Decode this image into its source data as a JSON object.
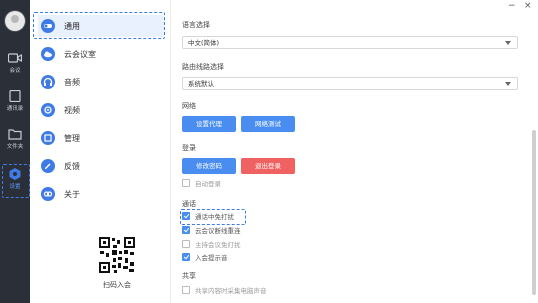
{
  "rail": {
    "items": [
      {
        "label": "会议",
        "icon": "video-camera-icon"
      },
      {
        "label": "通讯录",
        "icon": "contacts-icon"
      },
      {
        "label": "文件夹",
        "icon": "folder-icon"
      },
      {
        "label": "设置",
        "icon": "settings-icon",
        "active": true
      }
    ]
  },
  "categories": [
    {
      "label": "通用",
      "icon": "toggle-icon",
      "active": true
    },
    {
      "label": "云会议室",
      "icon": "cloud-icon"
    },
    {
      "label": "音频",
      "icon": "headphones-icon"
    },
    {
      "label": "视频",
      "icon": "video-icon"
    },
    {
      "label": "管理",
      "icon": "manage-icon"
    },
    {
      "label": "反馈",
      "icon": "feedback-icon"
    },
    {
      "label": "关于",
      "icon": "about-icon"
    }
  ],
  "qr": {
    "label": "扫码入会"
  },
  "window": {
    "minimize": "−",
    "close": "×"
  },
  "settings": {
    "language": {
      "title": "语言选择",
      "value": "中文(简体)"
    },
    "route": {
      "title": "路由线路选择",
      "value": "系统默认"
    },
    "network": {
      "title": "网络",
      "proxy_button": "设置代理",
      "test_button": "网络测试"
    },
    "login": {
      "title": "登录",
      "change_password_button": "修改密码",
      "logout_button": "退出登录",
      "auto_login": "自动登录"
    },
    "call": {
      "title": "通话",
      "options": [
        {
          "label": "通话中免打扰",
          "checked": true
        },
        {
          "label": "云会议断线重连",
          "checked": true
        },
        {
          "label": "主持会议免打扰",
          "checked": false
        },
        {
          "label": "入会提示音",
          "checked": true
        }
      ]
    },
    "share": {
      "title": "共享",
      "capture_sound": "共享内容时采集电脑声音"
    }
  },
  "colors": {
    "accent": "#4a8df0",
    "danger": "#f06262",
    "rail_bg": "#2b2f38"
  }
}
